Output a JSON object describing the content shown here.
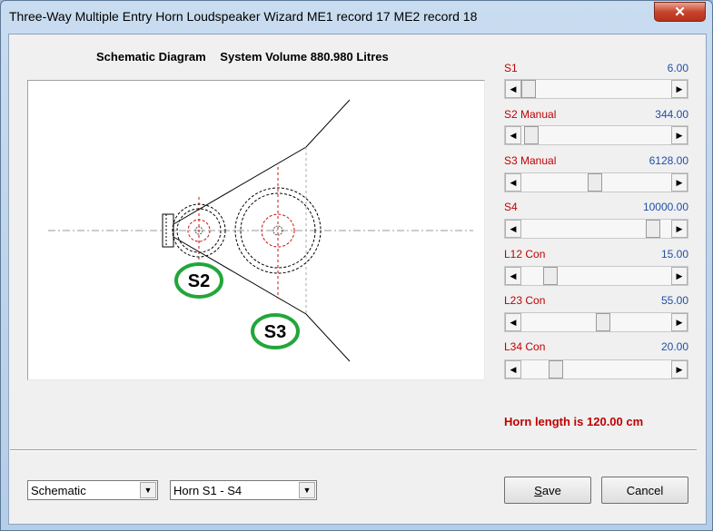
{
  "window": {
    "title": "Three-Way Multiple Entry Horn Loudspeaker Wizard   ME1 record 17   ME2 record 18",
    "close_glyph": "✕"
  },
  "diagram": {
    "title": "Schematic Diagram",
    "volume": "System Volume 880.980 Litres",
    "callout_s2": "S2",
    "callout_s3": "S3"
  },
  "params": [
    {
      "label": "S1",
      "value": "6.00",
      "fraction": 0.0
    },
    {
      "label": "S2  Manual",
      "value": "344.00",
      "fraction": 0.02
    },
    {
      "label": "S3  Manual",
      "value": "6128.00",
      "fraction": 0.49
    },
    {
      "label": "S4",
      "value": "10000.00",
      "fraction": 0.92
    },
    {
      "label": "L12  Con",
      "value": "15.00",
      "fraction": 0.16
    },
    {
      "label": "L23  Con",
      "value": "55.00",
      "fraction": 0.55
    },
    {
      "label": "L34  Con",
      "value": "20.00",
      "fraction": 0.2
    }
  ],
  "horn_length": "Horn length is 120.00 cm",
  "view_combo": {
    "selected": "Schematic"
  },
  "section_combo": {
    "selected": "Horn S1 - S4"
  },
  "buttons": {
    "save_prefix": "S",
    "save_rest": "ave",
    "cancel": "Cancel"
  },
  "icons": {
    "left_arrow": "◀",
    "right_arrow": "▶",
    "dropdown_arrow": "▼"
  },
  "colors": {
    "label_red": "#c00000",
    "value_blue": "#1f4fa8",
    "callout_green": "#22a63a"
  }
}
